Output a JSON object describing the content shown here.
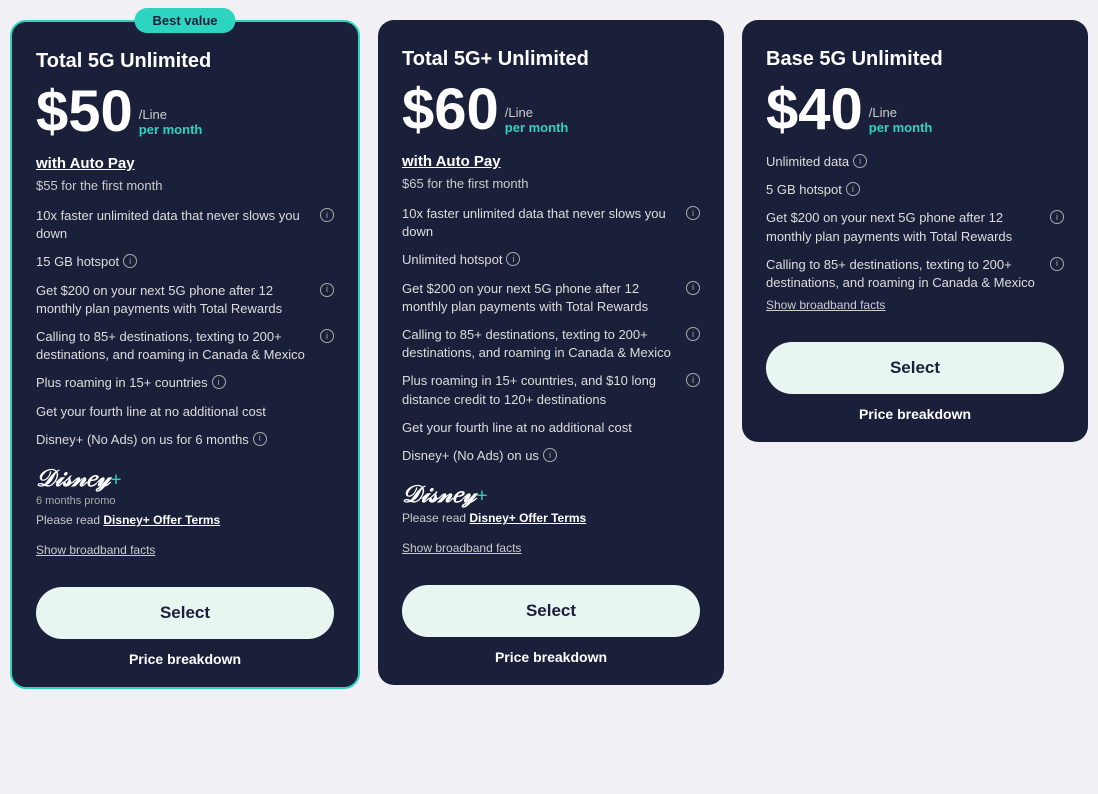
{
  "cards": [
    {
      "id": "total-5g",
      "featured": true,
      "badge": "Best value",
      "plan_name": "Total 5G Unlimited",
      "price": "$50",
      "per_line": "/Line",
      "per_month": "per month",
      "has_autopay": true,
      "autopay_label": "with Auto Pay",
      "first_month": "$55 for the first month",
      "features": [
        "10x faster unlimited data that never slows you down",
        "15 GB hotspot",
        "Get $200 on your next 5G phone after 12 monthly plan payments with Total Rewards",
        "Calling to 85+ destinations, texting to 200+ destinations, and roaming in Canada & Mexico",
        "Plus roaming in 15+ countries",
        "Get your fourth line at no additional cost",
        "Disney+ (No Ads) on us for 6 months"
      ],
      "features_info": [
        true,
        true,
        true,
        true,
        true,
        false,
        true
      ],
      "has_disney": true,
      "disney_promo": "6 months promo",
      "offer_terms_text": "Please read ",
      "offer_terms_link": "Disney+ Offer Terms",
      "broadband": "Show broadband facts",
      "select_label": "Select",
      "price_breakdown": "Price breakdown"
    },
    {
      "id": "total-5g-plus",
      "featured": false,
      "badge": null,
      "plan_name": "Total 5G+ Unlimited",
      "price": "$60",
      "per_line": "/Line",
      "per_month": "per month",
      "has_autopay": true,
      "autopay_label": "with Auto Pay",
      "first_month": "$65 for the first month",
      "features": [
        "10x faster unlimited data that never slows you down",
        "Unlimited hotspot",
        "Get $200 on your next 5G phone after 12 monthly plan payments with Total Rewards",
        "Calling to 85+ destinations, texting to 200+ destinations, and roaming in Canada & Mexico",
        "Plus roaming in 15+ countries, and $10 long distance credit to 120+ destinations",
        "Get your fourth line at no additional cost",
        "Disney+ (No Ads) on us"
      ],
      "features_info": [
        true,
        true,
        true,
        true,
        true,
        false,
        true
      ],
      "has_disney": true,
      "disney_promo": null,
      "offer_terms_text": "Please read ",
      "offer_terms_link": "Disney+ Offer Terms",
      "broadband": "Show broadband facts",
      "select_label": "Select",
      "price_breakdown": "Price breakdown"
    },
    {
      "id": "base-5g",
      "featured": false,
      "badge": null,
      "plan_name": "Base 5G Unlimited",
      "price": "$40",
      "per_line": "/Line",
      "per_month": "per month",
      "has_autopay": false,
      "autopay_label": null,
      "first_month": null,
      "features": [
        "Unlimited data",
        "5 GB hotspot",
        "Get $200 on your next 5G phone after 12 monthly plan payments with Total Rewards",
        "Calling to 85+ destinations, texting to 200+ destinations, and roaming in Canada & Mexico"
      ],
      "features_info": [
        true,
        true,
        true,
        true
      ],
      "has_disney": false,
      "disney_promo": null,
      "offer_terms_text": null,
      "offer_terms_link": null,
      "broadband": "Show broadband facts",
      "select_label": "Select",
      "price_breakdown": "Price breakdown"
    }
  ]
}
